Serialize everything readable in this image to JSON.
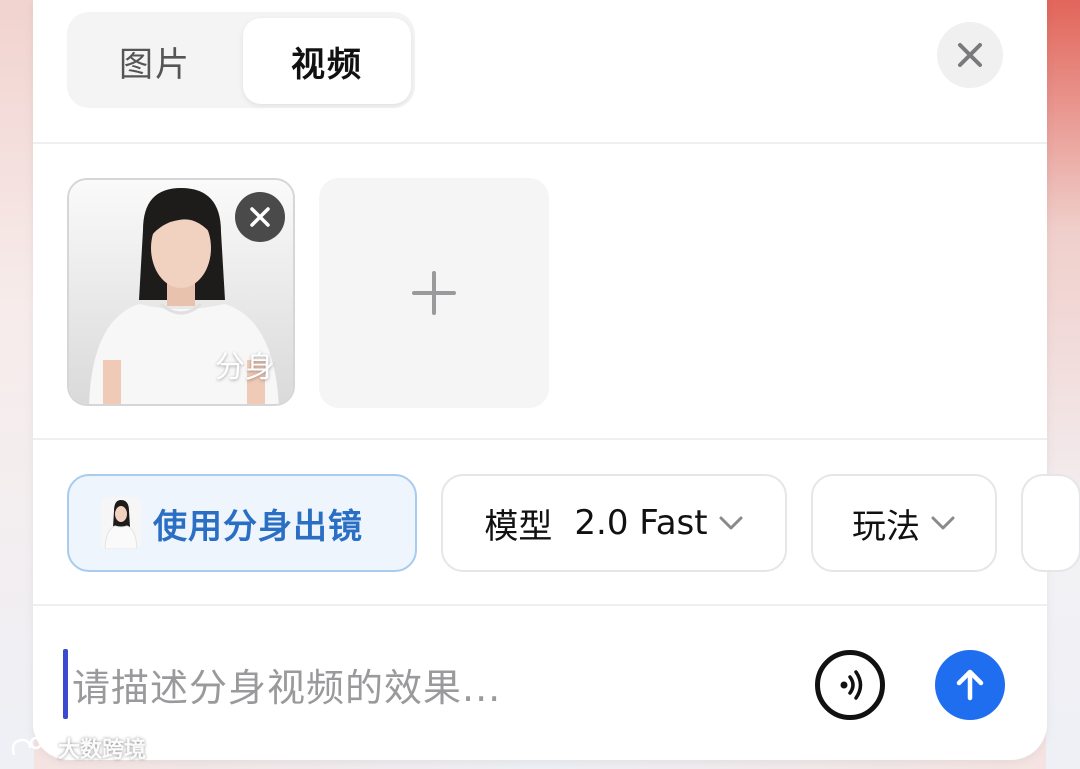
{
  "tabs": [
    {
      "label": "图片",
      "selected": false
    },
    {
      "label": "视频",
      "selected": true
    }
  ],
  "upload": {
    "thumbnail_label": "分身"
  },
  "options": {
    "avatar_chip_label": "使用分身出镜",
    "model_label": "模型",
    "model_value": "2.0 Fast",
    "play_label": "玩法"
  },
  "input": {
    "placeholder": "请描述分身视频的效果..."
  },
  "watermark": "大数跨境",
  "colors": {
    "accent_blue": "#1f6ef0",
    "chip_blue_text": "#2a6fc4",
    "caret": "#3b4bd0"
  }
}
